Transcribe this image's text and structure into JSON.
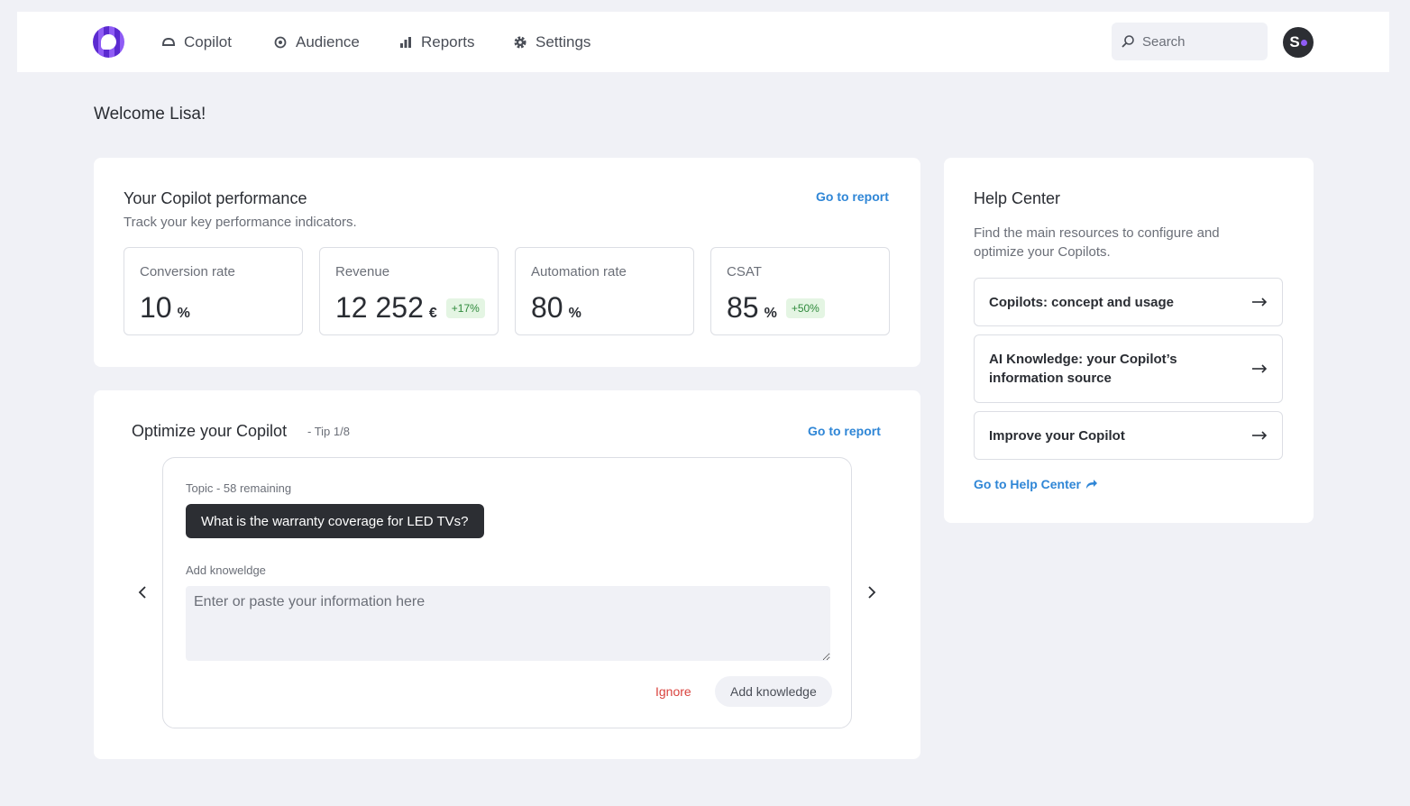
{
  "nav": {
    "items": [
      {
        "label": "Copilot"
      },
      {
        "label": "Audience"
      },
      {
        "label": "Reports"
      },
      {
        "label": "Settings"
      }
    ],
    "search_placeholder": "Search",
    "avatar_initial": "S"
  },
  "welcome": "Welcome Lisa!",
  "performance": {
    "title": "Your Copilot performance",
    "subtitle": "Track your key performance indicators.",
    "link": "Go to report",
    "kpis": [
      {
        "label": "Conversion rate",
        "value": "10",
        "unit": "%",
        "badge": ""
      },
      {
        "label": "Revenue",
        "value": "12 252",
        "unit": "€",
        "badge": "+17%"
      },
      {
        "label": "Automation rate",
        "value": "80",
        "unit": "%",
        "badge": ""
      },
      {
        "label": "CSAT",
        "value": "85",
        "unit": "%",
        "badge": "+50%"
      }
    ]
  },
  "optimize": {
    "title": "Optimize your Copilot",
    "tip": "- Tip 1/8",
    "link": "Go to report",
    "topic_label": "Topic - 58 remaining",
    "question": "What is the warranty coverage for LED TVs?",
    "add_label": "Add knoweldge",
    "textarea_placeholder": "Enter or paste your information here",
    "ignore": "Ignore",
    "add_button": "Add knowledge"
  },
  "help": {
    "title": "Help Center",
    "subtitle": "Find the main resources to configure and optimize your Copilots.",
    "items": [
      {
        "label": "Copilots: concept and usage"
      },
      {
        "label": "AI Knowledge: your Copilot’s information source"
      },
      {
        "label": "Improve your Copilot"
      }
    ],
    "link": "Go to Help Center"
  },
  "colors": {
    "accent_link": "#2f86d6",
    "danger": "#d9433e",
    "success_badge": "#2f8a3c",
    "brand_purple": "#5b2ad0"
  }
}
